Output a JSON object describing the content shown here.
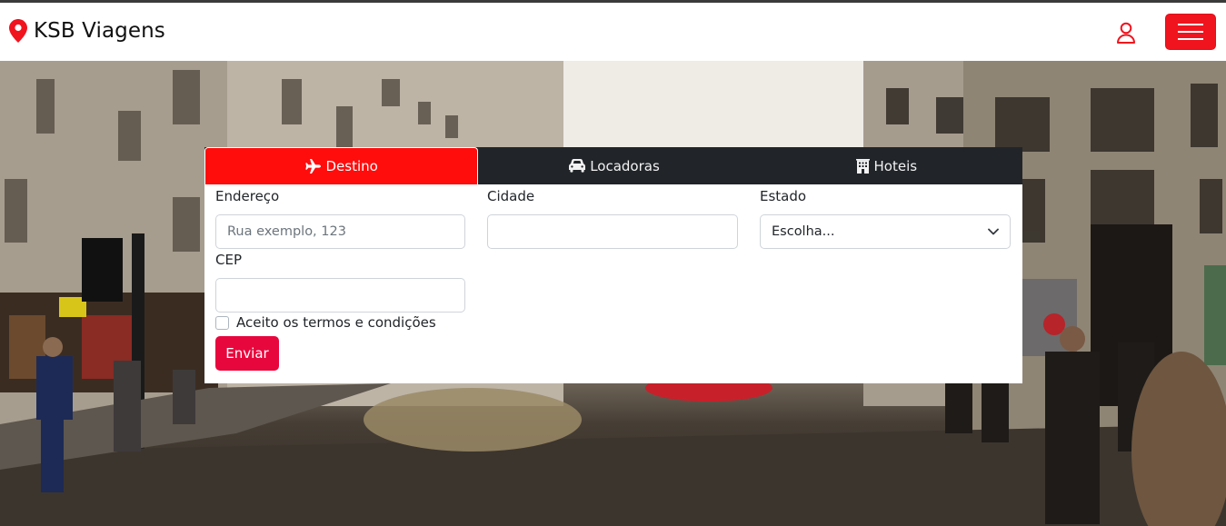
{
  "brand": {
    "name": "KSB Viagens",
    "icon": "map-pin-icon",
    "color": "#f0141e"
  },
  "navbar": {
    "user_icon": "user-icon",
    "menu_icon": "hamburger-icon",
    "accent": "#f0141e"
  },
  "tabs": [
    {
      "label": "Destino",
      "icon": "plane-icon",
      "active": true
    },
    {
      "label": "Locadoras",
      "icon": "car-icon",
      "active": false
    },
    {
      "label": "Hoteis",
      "icon": "building-icon",
      "active": false
    }
  ],
  "form": {
    "address": {
      "label": "Endereço",
      "placeholder": "Rua exemplo, 123",
      "value": ""
    },
    "city": {
      "label": "Cidade",
      "value": ""
    },
    "state": {
      "label": "Estado",
      "selected": "Escolha..."
    },
    "cep": {
      "label": "CEP",
      "value": ""
    },
    "terms": {
      "label": "Aceito os termos e condições",
      "checked": false
    },
    "submit_label": "Enviar"
  },
  "colors": {
    "tab_active": "#ff0d0d",
    "tab_bar": "#212529",
    "submit": "#e8073d"
  }
}
